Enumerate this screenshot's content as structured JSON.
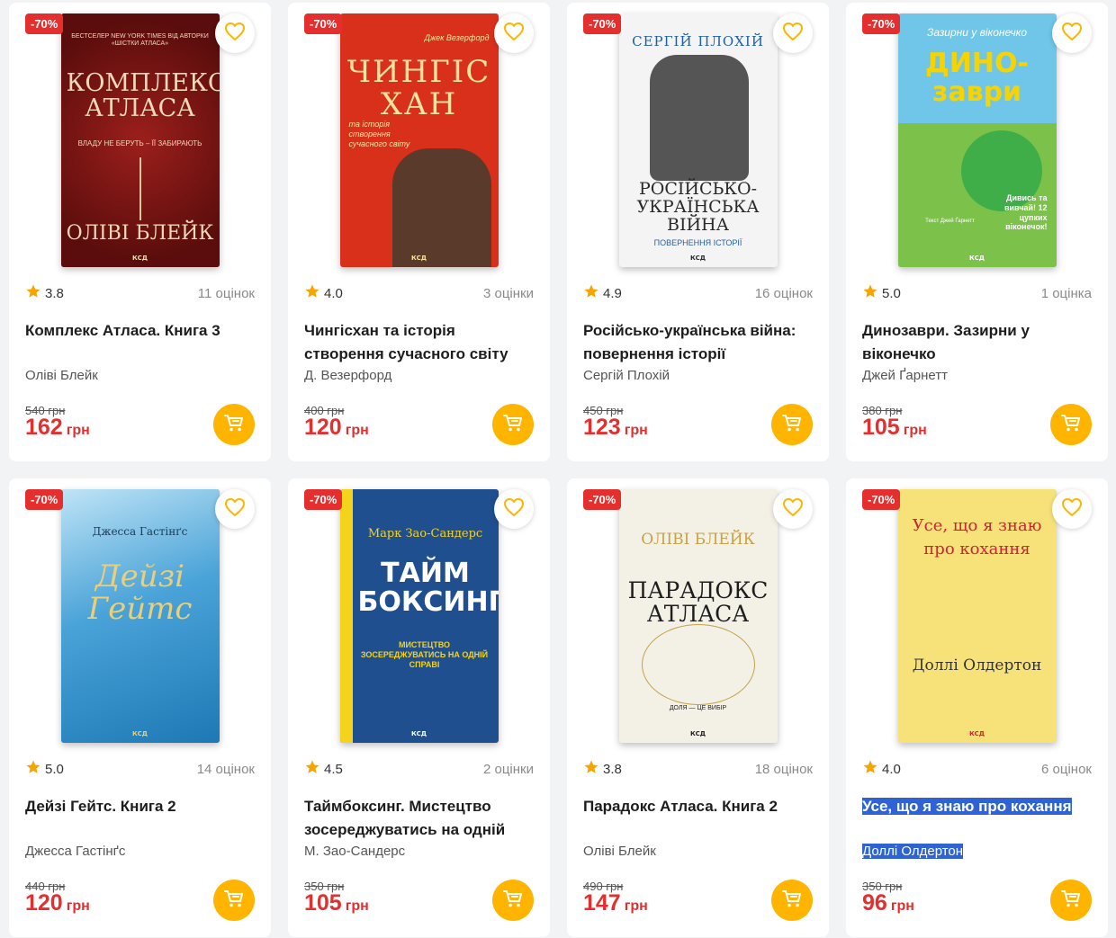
{
  "products": [
    {
      "discount": "-70%",
      "rating": "3.8",
      "reviews": "11 оцінок",
      "title": "Комплекс Атласа. Книга 3",
      "author": "Оліві Блейк",
      "old_price": "540 грн",
      "price": "162",
      "currency": "грн",
      "highlight": false,
      "cover": {
        "bg": "#7a1614",
        "fg": "#f1d9b8",
        "top": "БЕСТСЕЛЕР NEW YORK TIMES ВІД АВТОРКИ «ШІСТКИ АТЛАСА»",
        "title": "КОМПЛЕКС АТЛАСА",
        "sub": "ВЛАДУ НЕ БЕРУТЬ – ЇЇ ЗАБИРАЮТЬ",
        "author": "ОЛІВІ БЛЕЙК",
        "brand": "КСД"
      }
    },
    {
      "discount": "-70%",
      "rating": "4.0",
      "reviews": "3 оцінки",
      "title": "Чингісхан та історія створення сучасного світу",
      "author": "Д. Везерфорд",
      "old_price": "400 грн",
      "price": "120",
      "currency": "грн",
      "highlight": false,
      "cover": {
        "bg": "#d9301c",
        "fg": "#f7e3a1",
        "top": "Джек Везерфорд",
        "title": "ЧИНГІС ХАН",
        "sub": "та історія створення сучасного світу",
        "author": "",
        "brand": "КСД"
      }
    },
    {
      "discount": "-70%",
      "rating": "4.9",
      "reviews": "16 оцінок",
      "title": "Російсько-українська війна: повернення історії",
      "author": "Сергій Плохій",
      "old_price": "450 грн",
      "price": "123",
      "currency": "грн",
      "highlight": false,
      "cover": {
        "bg": "#f4f4f4",
        "fg": "#2a2a2a",
        "top": "СЕРГІЙ ПЛОХІЙ",
        "title": "РОСІЙСЬКО-УКРАЇНСЬКА ВІЙНА",
        "sub": "ПОВЕРНЕННЯ ІСТОРІЇ",
        "author": "",
        "brand": "КСД"
      }
    },
    {
      "discount": "-70%",
      "rating": "5.0",
      "reviews": "1 оцінка",
      "title": "Динозаври. Зазирни у віконечко",
      "author": "Джей Ґарнетт",
      "old_price": "380 грн",
      "price": "105",
      "currency": "грн",
      "highlight": false,
      "cover": {
        "bg": "#6fc6e8",
        "fg": "#ffffff",
        "top": "Зазирни у віконечко",
        "title": "ДИНО-заври",
        "sub": "Дивись та вивчай! 12 цупких віконечок!",
        "author": "Текст Джей Ґарнетт",
        "brand": "КСД"
      }
    },
    {
      "discount": "-70%",
      "rating": "5.0",
      "reviews": "14 оцінок",
      "title": "Дейзі Гейтс. Книга 2",
      "author": "Джесса Гастінґс",
      "old_price": "440 грн",
      "price": "120",
      "currency": "грн",
      "highlight": false,
      "cover": {
        "bg": "#5fb0e0",
        "fg": "#e9cf7a",
        "top": "Джесса Гастінґс",
        "title": "Дейзі Гейтс",
        "sub": "",
        "author": "",
        "brand": "КСД"
      }
    },
    {
      "discount": "-70%",
      "rating": "4.5",
      "reviews": "2 оцінки",
      "title": "Таймбоксинг. Мистецтво зосереджуватись на одній справі",
      "author": "М. Зао-Сандерс",
      "old_price": "350 грн",
      "price": "105",
      "currency": "грн",
      "highlight": false,
      "cover": {
        "bg": "#1f4f8f",
        "fg": "#ffffff",
        "top": "Марк Зао-Сандерс",
        "title": "ТАЙМ БОКСИНГ",
        "sub": "МИСТЕЦТВО ЗОСЕРЕДЖУВАТИСЬ НА ОДНІЙ СПРАВІ",
        "author": "",
        "brand": "КСД"
      }
    },
    {
      "discount": "-70%",
      "rating": "3.8",
      "reviews": "18 оцінок",
      "title": "Парадокс Атласа. Книга 2",
      "author": "Оліві Блейк",
      "old_price": "490 грн",
      "price": "147",
      "currency": "грн",
      "highlight": false,
      "cover": {
        "bg": "#f3f0e6",
        "fg": "#1e1e1e",
        "top": "ОЛІВІ БЛЕЙК",
        "title": "ПАРАДОКС АТЛАСА",
        "sub": "ДОЛЯ — ЦЕ ВИБІР",
        "author": "",
        "brand": "КСД"
      }
    },
    {
      "discount": "-70%",
      "rating": "4.0",
      "reviews": "6 оцінок",
      "title": "Усе, що я знаю про кохання",
      "author": "Доллі Олдертон",
      "old_price": "350 грн",
      "price": "96",
      "currency": "грн",
      "highlight": true,
      "cover": {
        "bg": "#f7e27a",
        "fg": "#d21f3c",
        "top": "",
        "title": "Усе, що я знаю про кохання",
        "sub": "",
        "author": "Доллі Олдертон",
        "brand": "КСД"
      }
    }
  ],
  "colors": {
    "accent": "#ffb400",
    "discount": "#e52e2e",
    "star": "#f5a400",
    "highlight": "#2f63d3"
  },
  "icons": {
    "favorite": "heart-outline-icon",
    "cart": "cart-icon",
    "rating": "star-icon"
  }
}
